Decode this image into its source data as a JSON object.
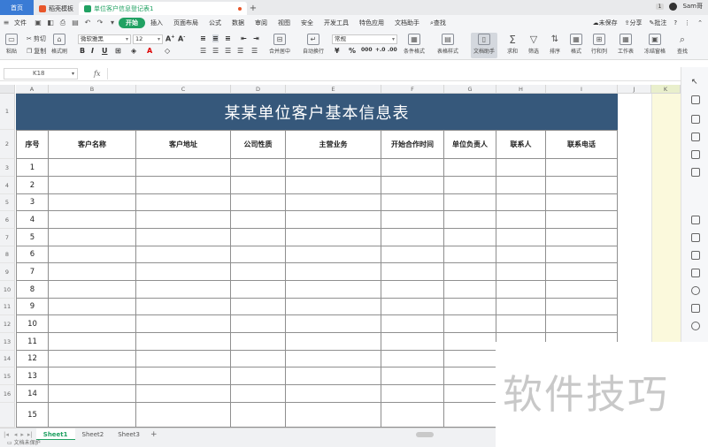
{
  "tabs": {
    "home": "首页",
    "template": "稻壳模板",
    "document": "单位客户信息登记表1"
  },
  "titlebar_right": {
    "badge": "1",
    "user": "Sam哥"
  },
  "menu": {
    "file": "文件",
    "items": [
      "开始",
      "插入",
      "页面布局",
      "公式",
      "数据",
      "审阅",
      "视图",
      "安全",
      "开发工具",
      "特色应用",
      "文档助手"
    ],
    "search": "查找",
    "unsaved": "未保存",
    "share": "分享",
    "comment": "批注"
  },
  "ribbon": {
    "paste": "粘贴",
    "cut": "剪切",
    "copy": "复制",
    "format_painter": "格式刷",
    "font_name": "微软雅黑",
    "font_size": "12",
    "merge_center": "合并居中",
    "wrap_text": "自动换行",
    "number_format": "常规",
    "conditional_format": "条件格式",
    "table_style": "表格样式",
    "doc_helper": "文档助手",
    "sum": "求和",
    "filter": "筛选",
    "sort": "排序",
    "format": "格式",
    "row_col": "行和列",
    "worksheet": "工作表",
    "freeze": "冻结窗格",
    "find": "查找"
  },
  "formula_bar": {
    "name_box": "K18",
    "fx": "fx"
  },
  "columns": [
    "A",
    "B",
    "C",
    "D",
    "E",
    "F",
    "G",
    "H",
    "I",
    "J",
    "K"
  ],
  "rows": [
    "1",
    "2",
    "3",
    "4",
    "5",
    "6",
    "7",
    "8",
    "9",
    "10",
    "11",
    "12",
    "13",
    "14",
    "15",
    "16"
  ],
  "sheet": {
    "title": "某某单位客户基本信息表",
    "headers": [
      "序号",
      "客户名称",
      "客户地址",
      "公司性质",
      "主营业务",
      "开始合作时间",
      "单位负责人",
      "联系人",
      "联系电话"
    ],
    "serial_numbers": [
      "1",
      "2",
      "3",
      "4",
      "5",
      "6",
      "7",
      "8",
      "9",
      "10",
      "11",
      "12",
      "13",
      "14",
      "15"
    ]
  },
  "sheet_tabs": [
    "Sheet1",
    "Sheet2",
    "Sheet3"
  ],
  "status": "文档未保护",
  "watermark": "软件技巧"
}
